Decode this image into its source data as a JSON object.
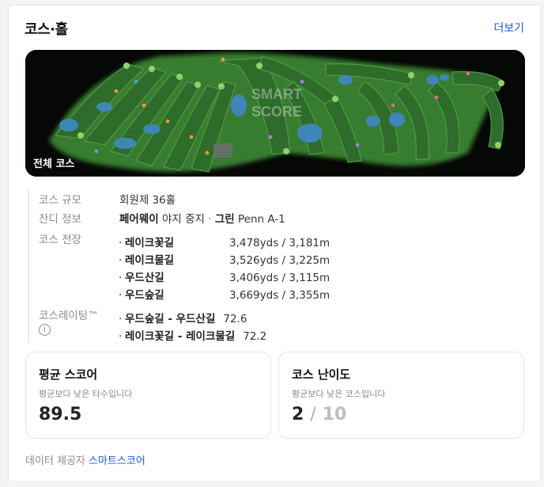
{
  "header": {
    "title": "코스·홀",
    "more_link": "더보기"
  },
  "map": {
    "label": "전체 코스",
    "watermark_line1": "SMART",
    "watermark_line2": "SCORE",
    "colors": {
      "background": "#050805",
      "fairway": "#2f6b2b",
      "glow": "#3e8a36",
      "water": "#3f86b8"
    }
  },
  "info": {
    "size_label": "코스 규모",
    "size_value": "회원제 36홀",
    "grass_label": "잔디 정보",
    "grass_fairway_name": "페어웨이",
    "grass_fairway_value": "야지 중지",
    "grass_sep": "·",
    "grass_green_name": "그린",
    "grass_green_value": "Penn A-1",
    "length_label": "코스 전장",
    "courses": [
      {
        "name": "레이크꽃길",
        "length": "3,478yds / 3,181m"
      },
      {
        "name": "레이크물길",
        "length": "3,526yds / 3,225m"
      },
      {
        "name": "우드산길",
        "length": "3,406yds / 3,115m"
      },
      {
        "name": "우드숲길",
        "length": "3,669yds / 3,355m"
      }
    ],
    "rating_label": "코스레이팅™",
    "info_icon": "i",
    "ratings": [
      {
        "name": "우드숲길 - 우드산길",
        "value": "72.6"
      },
      {
        "name": "레이크꽃길 - 레이크물길",
        "value": "72.2"
      }
    ],
    "bullet": "·"
  },
  "avg_score": {
    "title": "평균 스코어",
    "subtitle": "평균보다 낮은 타수입니다",
    "value": "89.5"
  },
  "difficulty": {
    "title": "코스 난이도",
    "subtitle": "평균보다 낮은 코스입니다",
    "value": "2",
    "separator": "/",
    "max": "10"
  },
  "provider": {
    "label": "데이터 제공자",
    "name": "스마트스코어"
  }
}
